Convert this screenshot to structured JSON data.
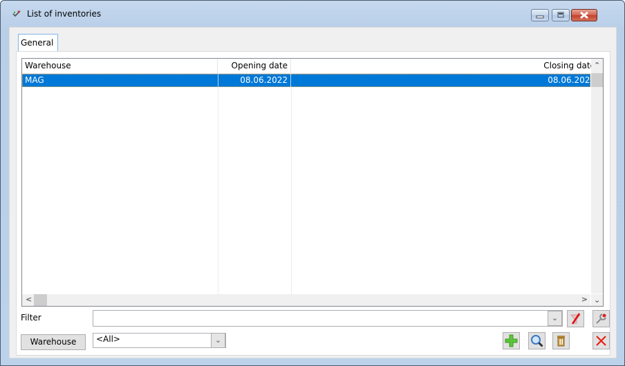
{
  "window": {
    "title": "List of inventories",
    "icon": "inventory-check-icon",
    "controls": [
      "minimize-icon",
      "maximize-icon",
      "close-icon"
    ]
  },
  "tabs": [
    {
      "label": "General",
      "active": true
    }
  ],
  "grid": {
    "columns": [
      {
        "label": "Warehouse",
        "align": "left"
      },
      {
        "label": "Opening date",
        "align": "right"
      },
      {
        "label": "Closing date",
        "align": "right"
      }
    ],
    "rows": [
      {
        "warehouse": "MAG",
        "opening_date": "08.06.2022",
        "closing_date": "08.06.2022",
        "selected": true
      }
    ],
    "selection_color": "#0078d7"
  },
  "filter": {
    "label": "Filter",
    "value": "",
    "clear_filter_icon": "funnel-clear-icon",
    "filter_settings_icon": "wrench-icon"
  },
  "warehouse_filter": {
    "button_label": "Warehouse",
    "selected": "<All>"
  },
  "actions": {
    "add_icon": "plus-icon",
    "view_icon": "magnifier-icon",
    "delete_icon": "trash-icon",
    "close_icon": "close-x-icon"
  }
}
